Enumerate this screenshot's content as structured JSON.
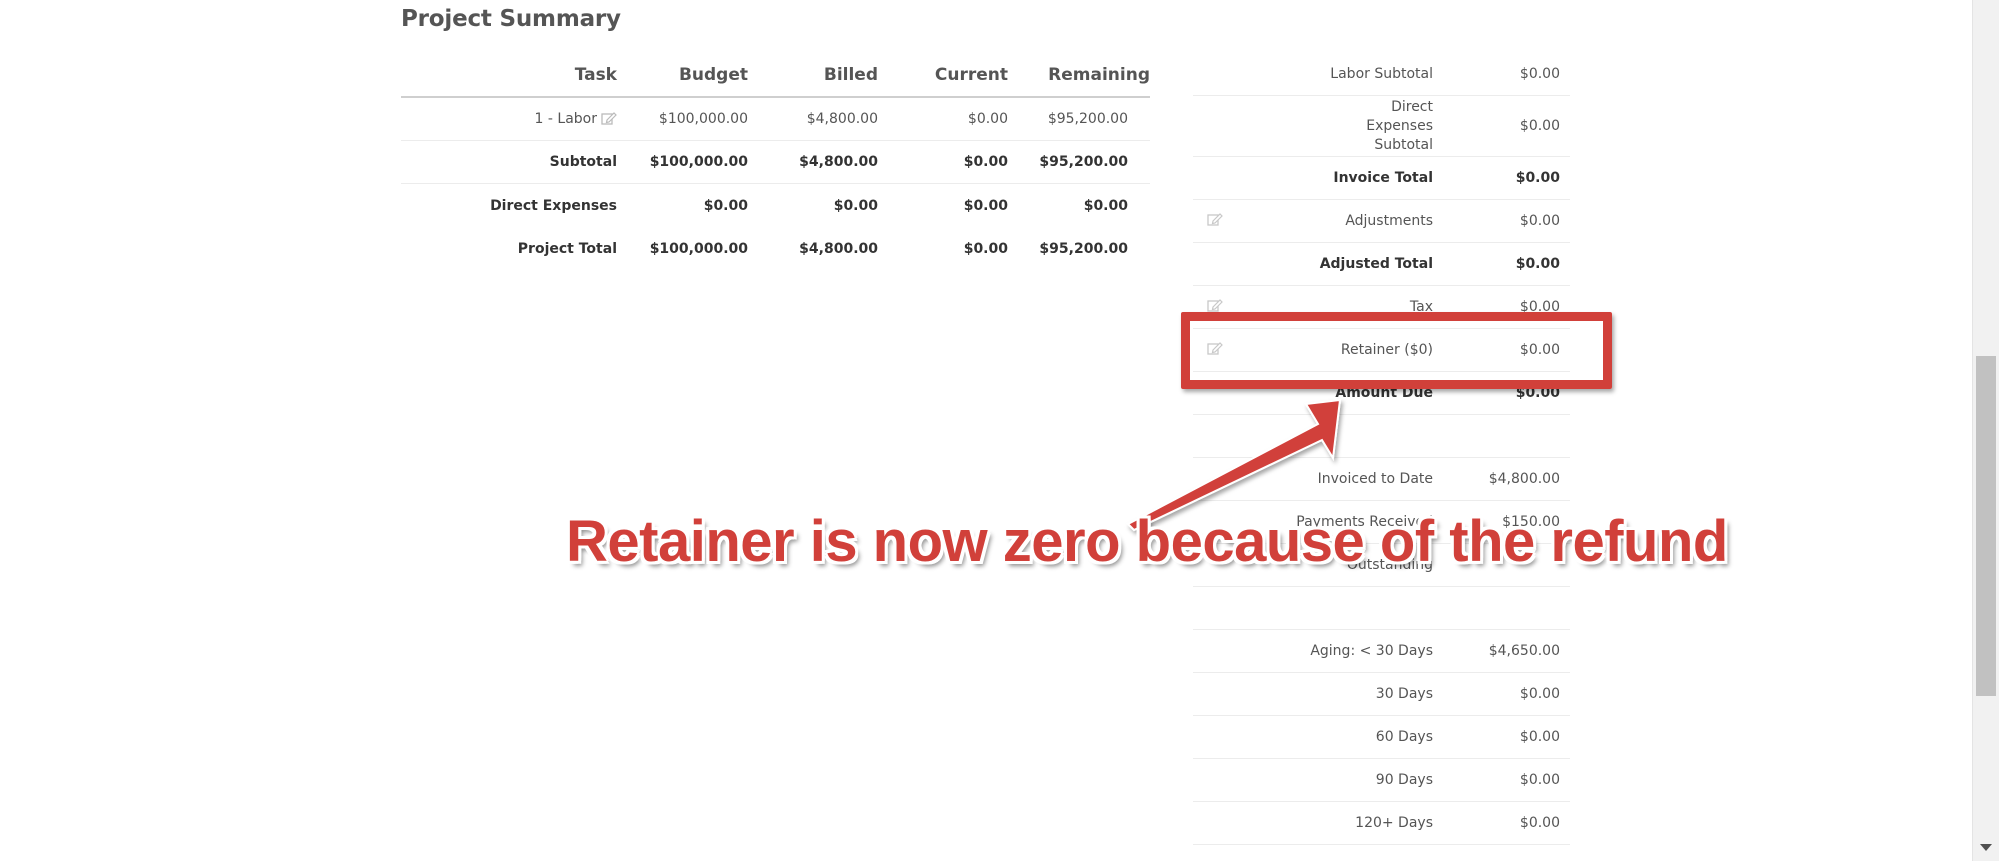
{
  "page_title": "Project Summary",
  "project_table": {
    "headers": [
      "Task",
      "Budget",
      "Billed",
      "Current",
      "Remaining"
    ],
    "rows": [
      {
        "task": "1 - Labor",
        "budget": "$100,000.00",
        "billed": "$4,800.00",
        "current": "$0.00",
        "remaining": "$95,200.00",
        "editable": true
      },
      {
        "task": "Subtotal",
        "budget": "$100,000.00",
        "billed": "$4,800.00",
        "current": "$0.00",
        "remaining": "$95,200.00"
      },
      {
        "task": "Direct Expenses",
        "budget": "$0.00",
        "billed": "$0.00",
        "current": "$0.00",
        "remaining": "$0.00"
      },
      {
        "task": "Project Total",
        "budget": "$100,000.00",
        "billed": "$4,800.00",
        "current": "$0.00",
        "remaining": "$95,200.00"
      }
    ]
  },
  "invoice_summary": {
    "rows": [
      {
        "label": "Labor Subtotal",
        "value": "$0.00"
      },
      {
        "label": "Direct Expenses Subtotal",
        "value": "$0.00"
      },
      {
        "label": "Invoice Total",
        "value": "$0.00"
      },
      {
        "label": "Adjustments",
        "value": "$0.00"
      },
      {
        "label": "Adjusted Total",
        "value": "$0.00"
      },
      {
        "label": "Tax",
        "value": "$0.00"
      },
      {
        "label": "Retainer ($0)",
        "value": "$0.00"
      },
      {
        "label": "Amount Due",
        "value": "$0.00"
      },
      {
        "label": "Invoiced to Date",
        "value": "$4,800.00"
      },
      {
        "label": "Payments Received",
        "value": "$150.00"
      },
      {
        "label": "Outstanding",
        "value": ""
      },
      {
        "label": "Aging: < 30 Days",
        "value": "$4,650.00"
      },
      {
        "label": "30 Days",
        "value": "$0.00"
      },
      {
        "label": "60 Days",
        "value": "$0.00"
      },
      {
        "label": "90 Days",
        "value": "$0.00"
      },
      {
        "label": "120+ Days",
        "value": "$0.00"
      }
    ]
  },
  "annotation": {
    "callout_text": "Retainer is now zero because of the refund",
    "highlight_color": "#d1403a"
  }
}
